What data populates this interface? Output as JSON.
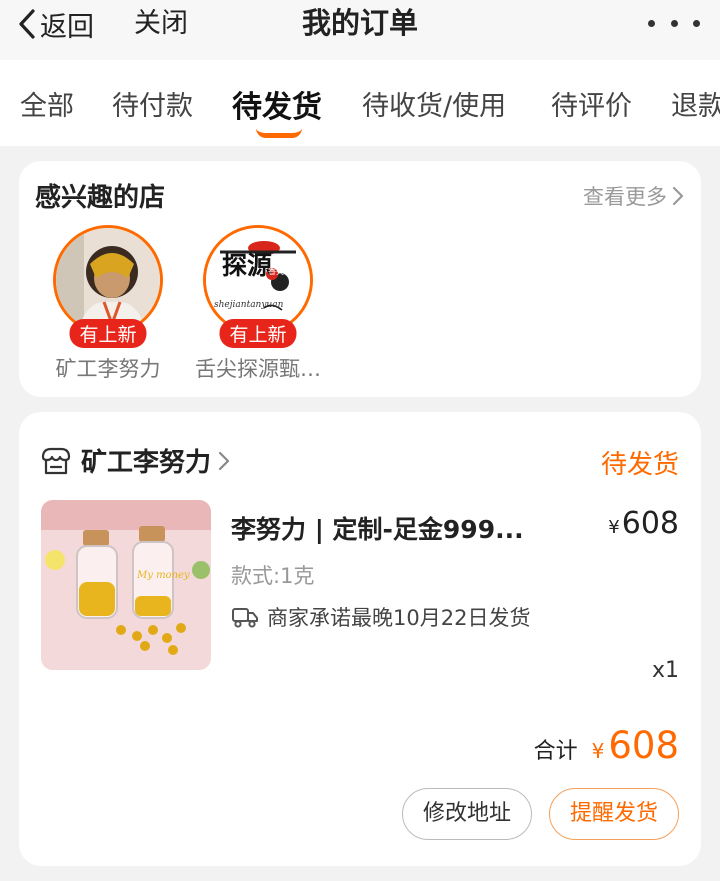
{
  "nav": {
    "back_label": "返回",
    "close_label": "关闭",
    "title": "我的订单"
  },
  "tabs": [
    {
      "label": "全部"
    },
    {
      "label": "待付款"
    },
    {
      "label": "待发货",
      "active": true
    },
    {
      "label": "待收货/使用"
    },
    {
      "label": "待评价"
    },
    {
      "label": "退款"
    }
  ],
  "shops": {
    "title": "感兴趣的店",
    "see_more": "查看更多",
    "items": [
      {
        "name": "矿工李努力",
        "badge": "有上新"
      },
      {
        "name": "舌尖探源甄…",
        "badge": "有上新",
        "logo_text": "探源",
        "logo_sub": "shejiantanyuan",
        "logo_mark": "香尖"
      }
    ]
  },
  "order": {
    "store_name": "矿工李努力",
    "status": "待发货",
    "product": {
      "title": "李努力 | 定制-足金999...",
      "price": "608",
      "currency": "¥",
      "spec": "款式:1克",
      "ship_promise": "商家承诺最晚10月22日发货",
      "quantity": "x1",
      "image_text": "My money"
    },
    "total_label": "合计",
    "total_currency": "¥",
    "total_value": "608",
    "buttons": {
      "modify": "修改地址",
      "remind": "提醒发货"
    }
  },
  "colors": {
    "accent": "#ff6a00",
    "badge": "#e8251a",
    "background": "#f2f2f2"
  }
}
